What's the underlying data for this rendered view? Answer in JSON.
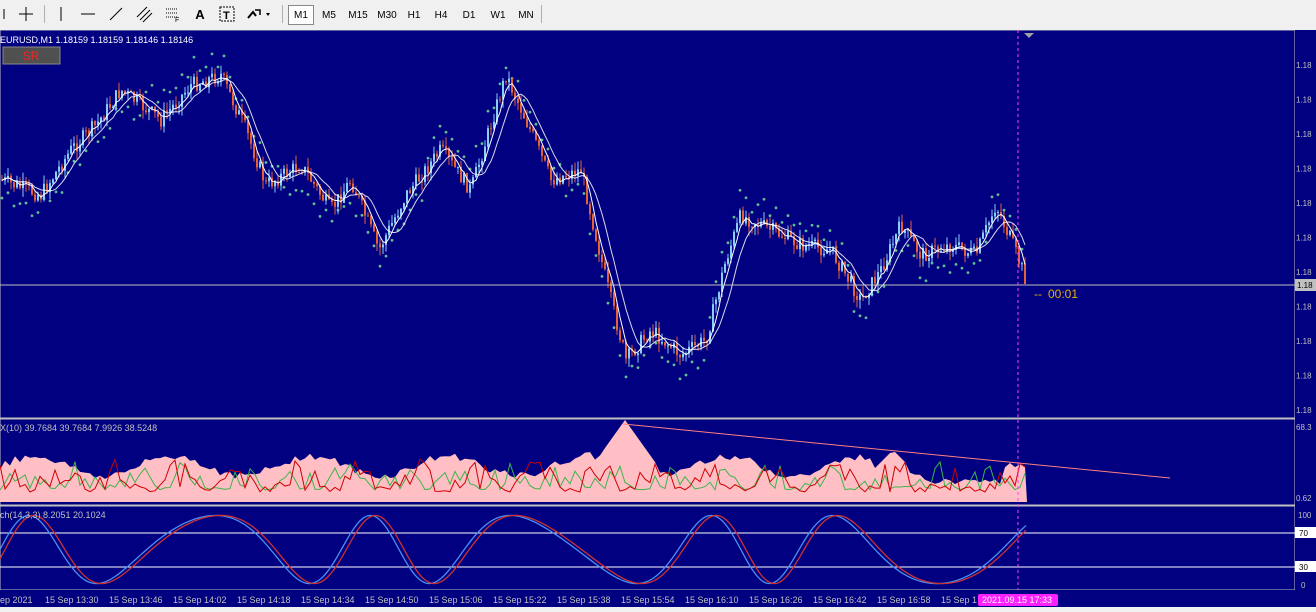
{
  "toolbar": {
    "timeframes": [
      "M1",
      "M5",
      "M15",
      "M30",
      "H1",
      "H4",
      "D1",
      "W1",
      "MN"
    ],
    "active_timeframe": "M1",
    "tools": [
      "crosshair-icon",
      "vertical-line-icon",
      "horizontal-line-icon",
      "trendline-icon",
      "channel-icon",
      "fibonacci-icon",
      "text-icon",
      "label-icon",
      "arrows-icon"
    ]
  },
  "chart": {
    "header": "EURUSD,M1  1.18159 1.18159 1.18146 1.18146",
    "sr_label": "SR",
    "countdown": "00:01",
    "price_tick_labels": [
      "1.18",
      "1.18",
      "1.18",
      "1.18",
      "1.18",
      "1.18",
      "1.18",
      "1.18",
      "1.18",
      "1.18",
      "1.18"
    ],
    "current_price_label": "1.18"
  },
  "adx_panel": {
    "header": "X(10) 39.7684 39.7684 7.9926 38.5248",
    "top_value": "68.3",
    "bottom_value": "0.62"
  },
  "stoch_panel": {
    "header": "ch(14,3,3) 8.2051 20.1024",
    "levels": [
      "100",
      "70",
      "30",
      "0"
    ]
  },
  "time_axis": {
    "labels": [
      "ep 2021",
      "15 Sep 13:30",
      "15 Sep 13:46",
      "15 Sep 14:02",
      "15 Sep 14:18",
      "15 Sep 14:34",
      "15 Sep 14:50",
      "15 Sep 15:06",
      "15 Sep 15:22",
      "15 Sep 15:38",
      "15 Sep 15:54",
      "15 Sep 16:10",
      "15 Sep 16:26",
      "15 Sep 16:42",
      "15 Sep 16:58",
      "15 Sep 1"
    ],
    "cursor_time": "2021.09.15 17:33"
  },
  "colors": {
    "background": "#000080",
    "bull": "#87cefa",
    "bear": "#e2603a",
    "sar": "#5fbf8f",
    "ma": "#ffffff",
    "adx_fill": "#ffbfc4",
    "plus_di": "#3cb44b",
    "minus_di": "#d00000",
    "stoch_main": "#4a8ff0",
    "stoch_signal": "#d03030",
    "cursor": "#ff00ff"
  }
}
